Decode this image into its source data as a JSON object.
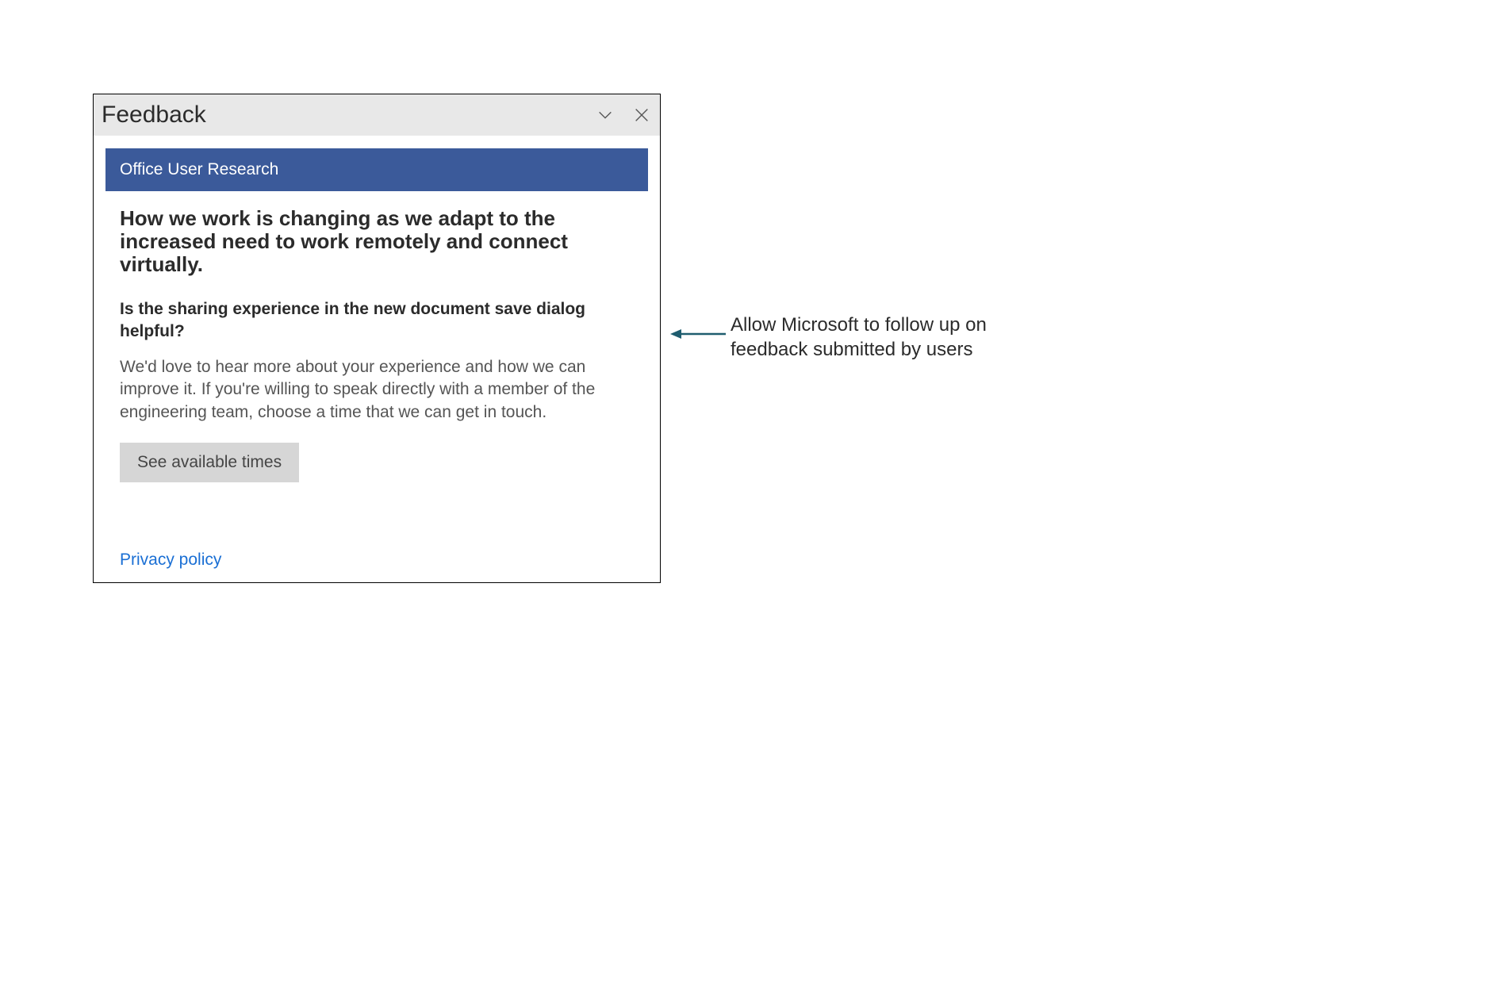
{
  "panel": {
    "title": "Feedback",
    "banner": "Office User Research",
    "heading": "How we work is changing as we adapt to the increased need to work remotely and connect virtually.",
    "subheading": "Is the sharing experience in the new document save dialog helpful?",
    "body": "We'd love to hear more about your experience and how we can improve it. If you're willing to speak directly with a member of the engineering team, choose a time that we can get in touch.",
    "cta_label": "See available times",
    "privacy_label": "Privacy policy"
  },
  "annotation": {
    "text": "Allow Microsoft to follow up on feedback submitted by users"
  },
  "colors": {
    "banner_bg": "#3b5a9a",
    "header_bg": "#e8e8e8",
    "button_bg": "#d6d6d6",
    "link": "#1a6fd4",
    "arrow": "#1f5d6f"
  }
}
